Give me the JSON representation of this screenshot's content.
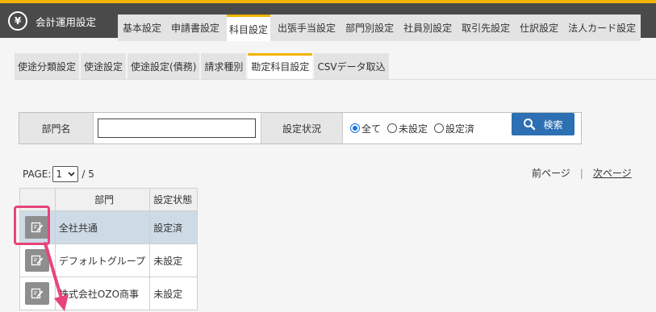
{
  "app": {
    "title": "会計運用設定",
    "logo_glyph": "¥",
    "accent": "#f2b400"
  },
  "main_tabs": [
    {
      "label": "基本設定"
    },
    {
      "label": "申請書設定"
    },
    {
      "label": "科目設定",
      "active": true
    },
    {
      "label": "出張手当設定"
    },
    {
      "label": "部門別設定"
    },
    {
      "label": "社員別設定"
    },
    {
      "label": "取引先設定"
    },
    {
      "label": "仕訳設定"
    },
    {
      "label": "法人カード設定"
    }
  ],
  "sub_tabs": [
    {
      "label": "使途分類設定"
    },
    {
      "label": "使途設定"
    },
    {
      "label": "使途設定(債務)"
    },
    {
      "label": "請求種別"
    },
    {
      "label": "勘定科目設定",
      "active": true
    },
    {
      "label": "CSVデータ取込"
    }
  ],
  "search": {
    "dept_label": "部門名",
    "dept_value": "",
    "status_label": "設定状況",
    "options": [
      {
        "label": "全て",
        "checked": true
      },
      {
        "label": "未設定",
        "checked": false
      },
      {
        "label": "設定済",
        "checked": false
      }
    ],
    "button_label": "検索"
  },
  "pager": {
    "label": "PAGE:",
    "current": "1",
    "total": "/ 5",
    "prev": "前ページ",
    "separator": "|",
    "next": "次ページ"
  },
  "table": {
    "headers": [
      "",
      "部門",
      "設定状態"
    ],
    "rows": [
      {
        "dept": "全社共通",
        "status": "設定済",
        "selected": true
      },
      {
        "dept": "デフォルトグループ",
        "status": "未設定",
        "selected": false
      },
      {
        "dept": "株式会社OZO商事",
        "status": "未設定",
        "selected": false
      }
    ]
  },
  "annotation": {
    "color": "#e8447a"
  }
}
